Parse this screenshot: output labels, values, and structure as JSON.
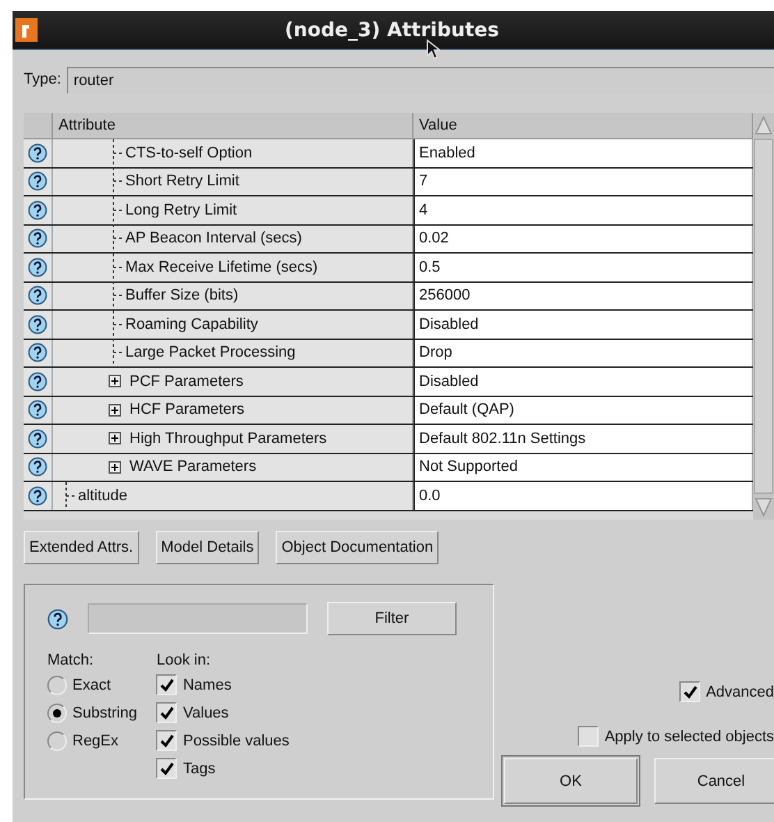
{
  "window": {
    "title": "(node_3) Attributes"
  },
  "type": {
    "label": "Type:",
    "value": "router"
  },
  "table": {
    "columns": [
      "Attribute",
      "Value"
    ],
    "rows": [
      {
        "kind": "sub-item",
        "attribute": "CTS-to-self Option",
        "value": "Enabled"
      },
      {
        "kind": "sub-item",
        "attribute": "Short Retry Limit",
        "value": "7"
      },
      {
        "kind": "sub-item",
        "attribute": "Long Retry Limit",
        "value": "4"
      },
      {
        "kind": "sub-item",
        "attribute": "AP Beacon Interval (secs)",
        "value": "0.02"
      },
      {
        "kind": "sub-item",
        "attribute": "Max Receive Lifetime (secs)",
        "value": "0.5"
      },
      {
        "kind": "sub-item",
        "attribute": "Buffer Size (bits)",
        "value": "256000"
      },
      {
        "kind": "sub-item",
        "attribute": "Roaming Capability",
        "value": "Disabled"
      },
      {
        "kind": "sub-item",
        "attribute": "Large Packet Processing",
        "value": "Drop"
      },
      {
        "kind": "sub-group",
        "attribute": "PCF Parameters",
        "value": "Disabled"
      },
      {
        "kind": "sub-group",
        "attribute": "HCF Parameters",
        "value": "Default (QAP)"
      },
      {
        "kind": "sub-group",
        "attribute": "High Throughput Parameters",
        "value": "Default 802.11n Settings"
      },
      {
        "kind": "sub-group",
        "attribute": "WAVE Parameters",
        "value": "Not Supported"
      },
      {
        "kind": "item",
        "attribute": "altitude",
        "value": "0.0"
      }
    ]
  },
  "buttons": [
    "Extended Attrs.",
    "Model Details",
    "Object Documentation"
  ],
  "filter": {
    "button": "Filter",
    "match_label": "Match:",
    "match": [
      {
        "label": "Exact",
        "selected": false
      },
      {
        "label": "Substring",
        "selected": true
      },
      {
        "label": "RegEx",
        "selected": false
      }
    ],
    "look_in_label": "Look in:",
    "look_in": [
      {
        "label": "Names",
        "checked": true
      },
      {
        "label": "Values",
        "checked": true
      },
      {
        "label": "Possible values",
        "checked": true
      },
      {
        "label": "Tags",
        "checked": true
      }
    ]
  },
  "advanced": {
    "label": "Advanced",
    "checked": true
  },
  "apply_selected": {
    "label": "Apply to selected objects",
    "checked": false
  },
  "actions": [
    "OK",
    "Cancel"
  ]
}
